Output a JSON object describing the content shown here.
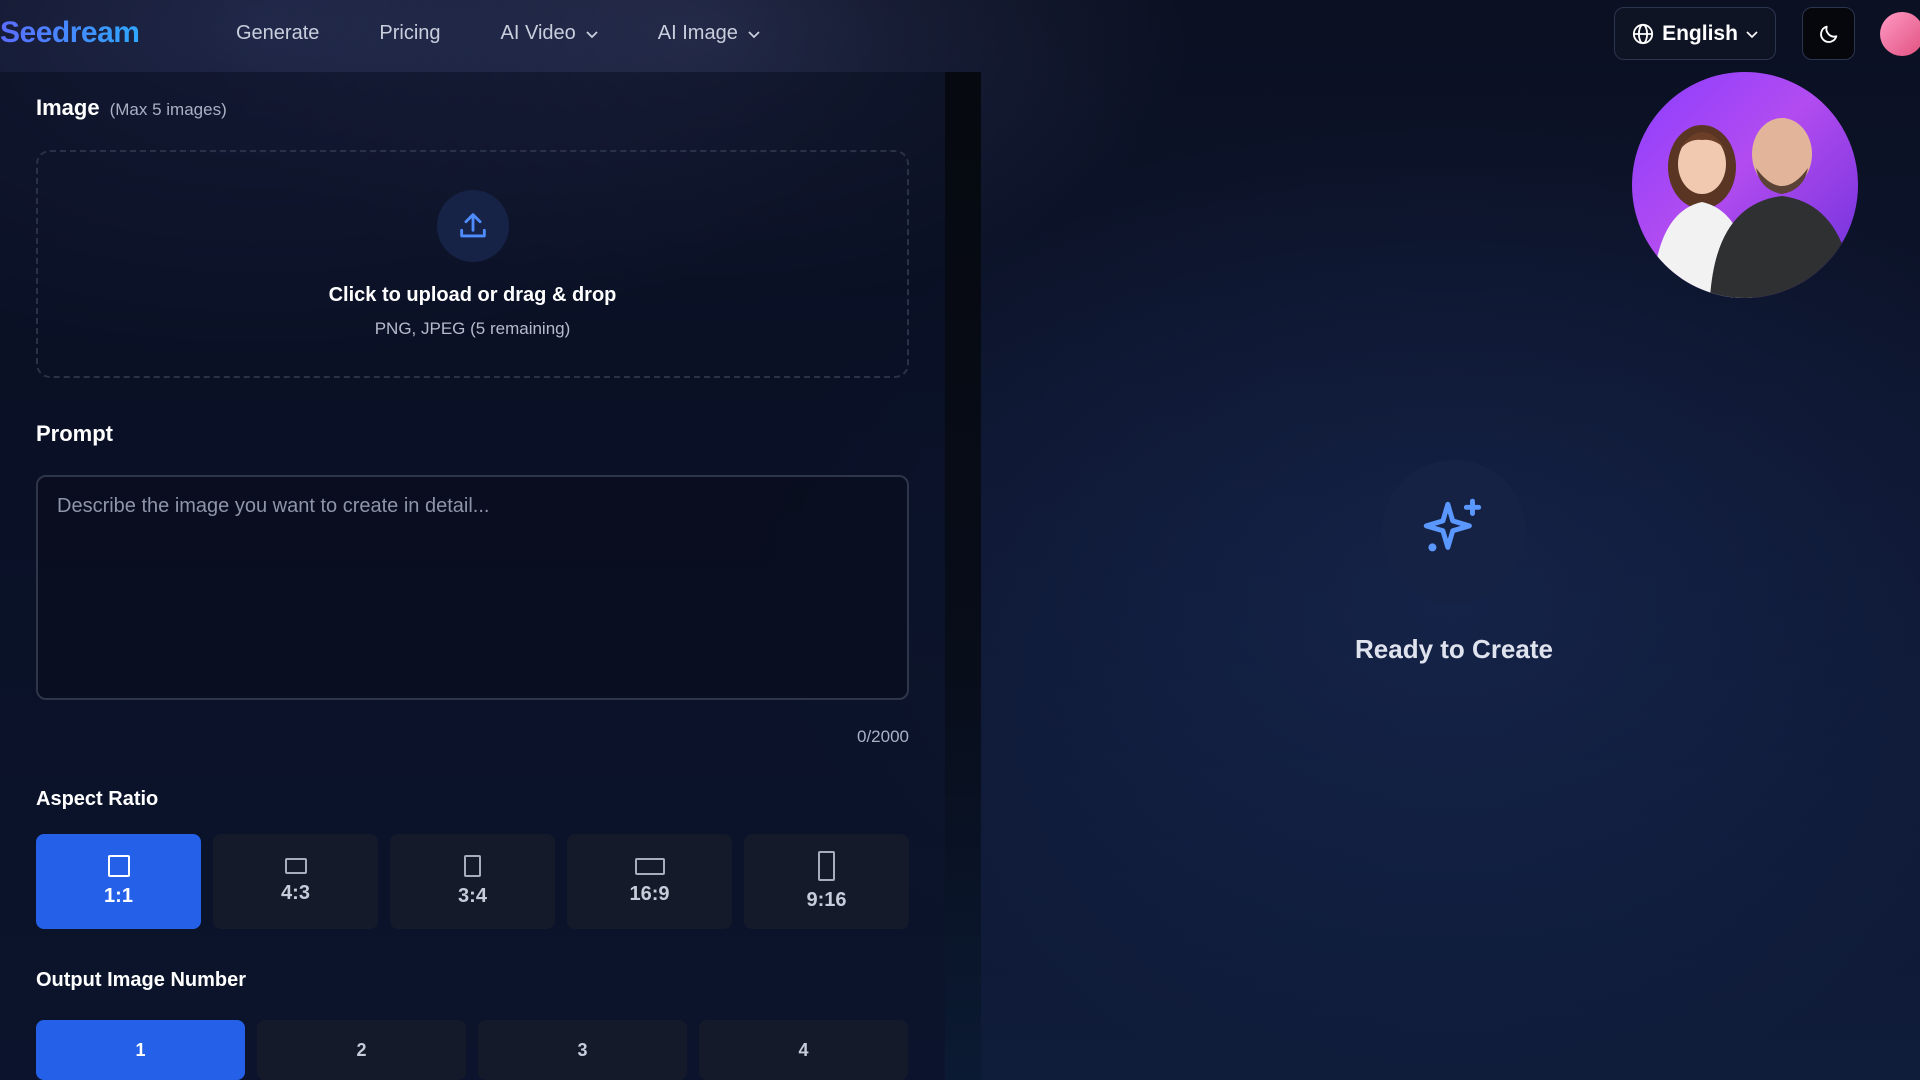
{
  "brand": {
    "logo": "Seedream"
  },
  "nav": {
    "links": [
      {
        "label": "Generate"
      },
      {
        "label": "Pricing"
      },
      {
        "label": "AI Video"
      },
      {
        "label": "AI Image"
      }
    ],
    "language": "English"
  },
  "image_section": {
    "title": "Image",
    "hint": "(Max 5 images)",
    "upload_title": "Click to upload or drag & drop",
    "upload_sub": "PNG, JPEG (5 remaining)"
  },
  "prompt_section": {
    "title": "Prompt",
    "placeholder": "Describe the image you want to create in detail...",
    "counter": "0/2000"
  },
  "aspect_section": {
    "title": "Aspect Ratio",
    "options": [
      {
        "label": "1:1",
        "active": true
      },
      {
        "label": "4:3",
        "active": false
      },
      {
        "label": "3:4",
        "active": false
      },
      {
        "label": "16:9",
        "active": false
      },
      {
        "label": "9:16",
        "active": false
      }
    ]
  },
  "output_section": {
    "title": "Output Image Number",
    "options": [
      {
        "label": "1",
        "active": true
      },
      {
        "label": "2",
        "active": false
      },
      {
        "label": "3",
        "active": false
      },
      {
        "label": "4",
        "active": false
      }
    ]
  },
  "preview": {
    "status": "Ready to Create"
  },
  "icons": {
    "globe": "globe-icon",
    "theme": "moon-icon",
    "upload": "upload-icon",
    "sparkle": "sparkles-icon"
  },
  "colors": {
    "accent": "#2561e8",
    "brand_gradient_start": "#5b6cff",
    "brand_gradient_end": "#2fa7ff"
  }
}
